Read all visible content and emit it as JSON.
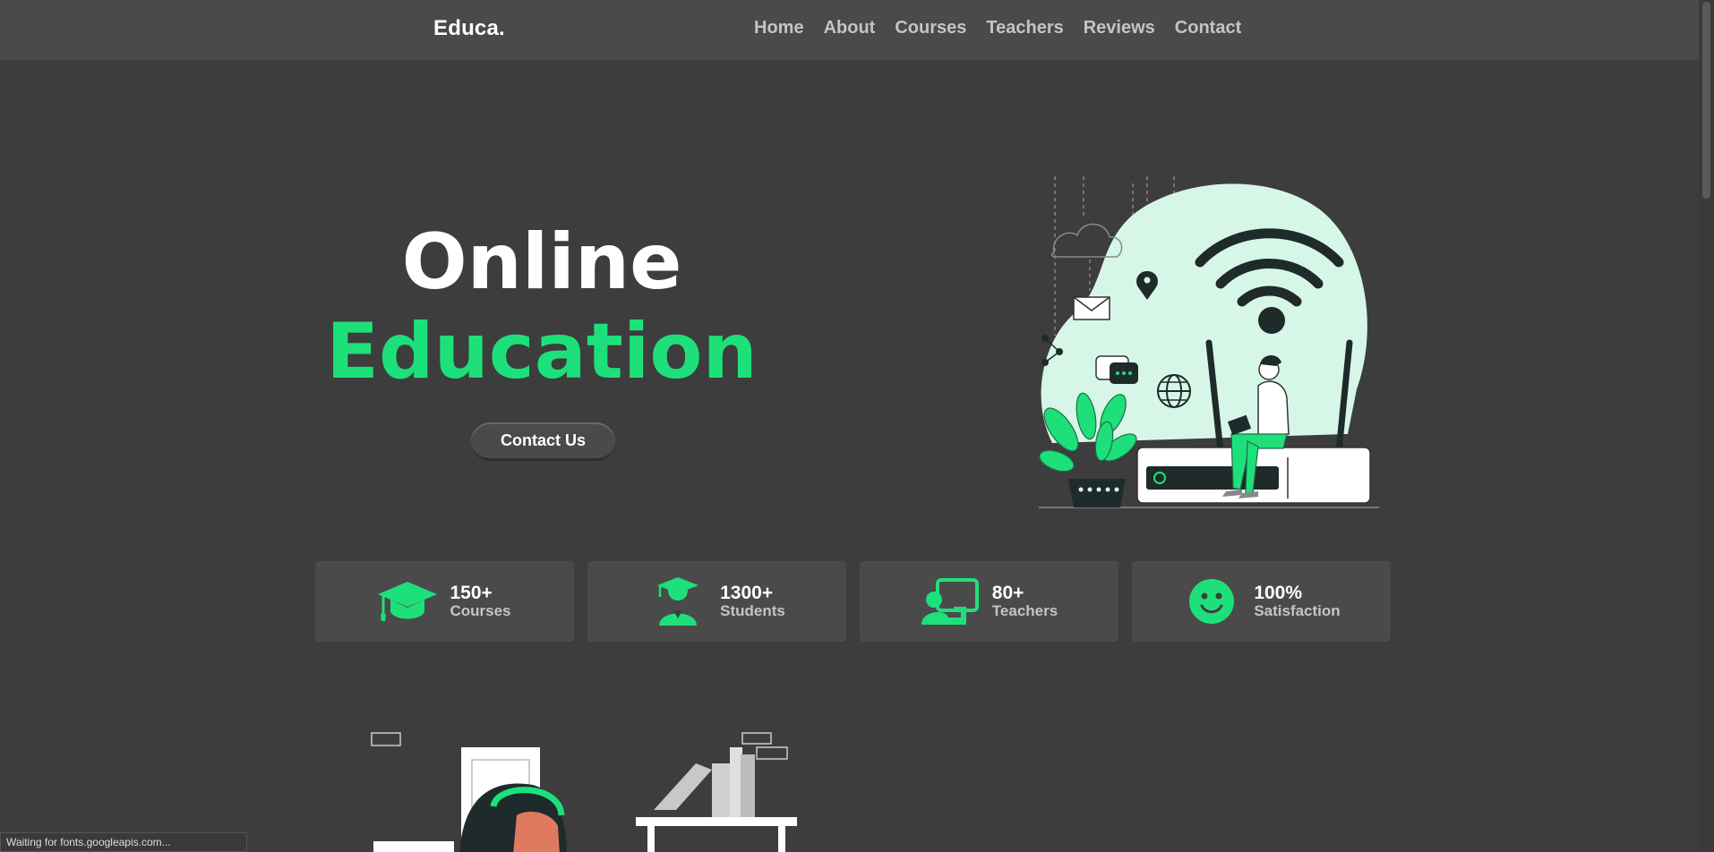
{
  "header": {
    "logo": "Educa.",
    "nav": [
      "Home",
      "About",
      "Courses",
      "Teachers",
      "Reviews",
      "Contact"
    ]
  },
  "hero": {
    "title_line1": "Online",
    "title_line2": "Education",
    "cta_label": "Contact Us"
  },
  "stats": [
    {
      "icon": "graduation-cap-icon",
      "value": "150+",
      "label": "Courses"
    },
    {
      "icon": "student-icon",
      "value": "1300+",
      "label": "Students"
    },
    {
      "icon": "teacher-icon",
      "value": "80+",
      "label": "Teachers"
    },
    {
      "icon": "smile-icon",
      "value": "100%",
      "label": "Satisfaction"
    }
  ],
  "statusbar": {
    "text": "Waiting for fonts.googleapis.com..."
  },
  "colors": {
    "accent": "#1ee07a",
    "bg": "#3d3d3d",
    "panel": "#4a4a4a",
    "mint": "#d6f7e7"
  }
}
